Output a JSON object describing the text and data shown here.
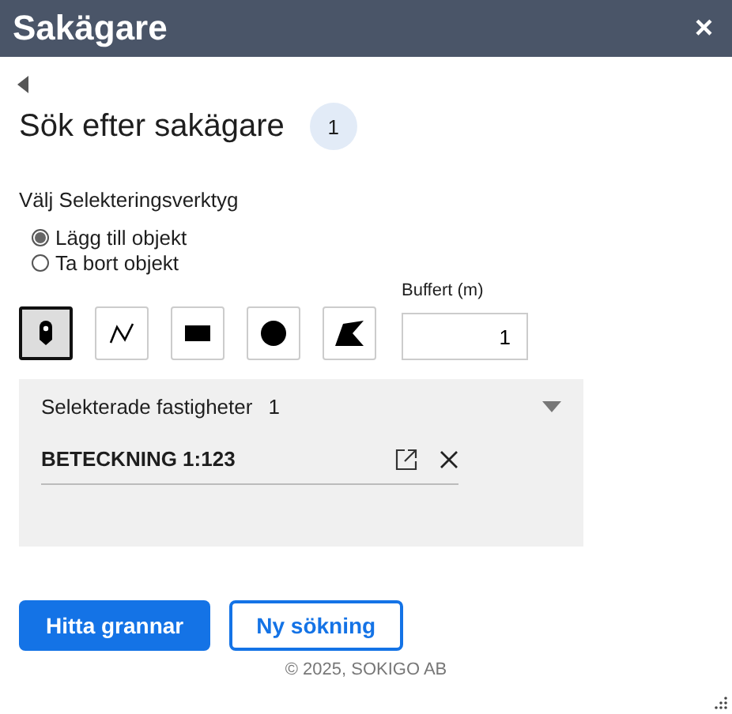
{
  "header": {
    "title": "Sakägare",
    "close": "×"
  },
  "page": {
    "title": "Sök efter sakägare",
    "badge": "1"
  },
  "selection": {
    "label": "Välj Selekteringsverktyg",
    "modes": [
      {
        "label": "Lägg till objekt",
        "selected": true
      },
      {
        "label": "Ta bort objekt",
        "selected": false
      }
    ]
  },
  "tools": [
    {
      "kind": "point",
      "selected": true
    },
    {
      "kind": "line",
      "selected": false
    },
    {
      "kind": "rectangle",
      "selected": false
    },
    {
      "kind": "circle",
      "selected": false
    },
    {
      "kind": "polygon",
      "selected": false
    }
  ],
  "buffer": {
    "label": "Buffert (m)",
    "value": "1"
  },
  "selected_panel": {
    "title": "Selekterade fastigheter",
    "count": "1",
    "expanded": true,
    "items": [
      {
        "label": "BETECKNING 1:123"
      }
    ]
  },
  "buttons": [
    {
      "label": "Hitta grannar",
      "kind": "primary"
    },
    {
      "label": "Ny sökning",
      "kind": "secondary"
    }
  ],
  "footer": "© 2025, SOKIGO AB"
}
